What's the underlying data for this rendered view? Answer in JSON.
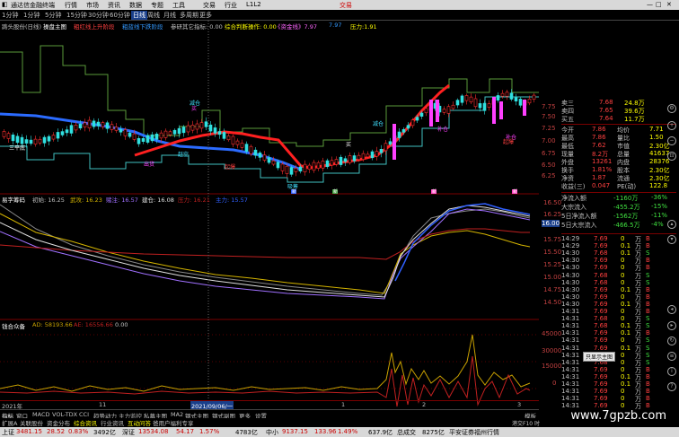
{
  "window": {
    "title": "通达信金融终端",
    "menus": [
      "行情",
      "市场",
      "资讯",
      "数据",
      "专题",
      "工具",
      "交易",
      "行业",
      "L1L2"
    ],
    "trade_label": "交易"
  },
  "periods": [
    "1分钟",
    "1分钟",
    "5分钟",
    "15分钟",
    "30分钟",
    "60分钟",
    "日线",
    "周线",
    "月线",
    "多周期",
    "更多"
  ],
  "selected_period": "日线",
  "indicator_bar": {
    "stock": "踌头股份(日线)",
    "item1": "操盘主图",
    "item2": "粗红线上升阶段",
    "item3": "粗蓝线下跌阶段",
    "item4": "参研其它指标: 0.00",
    "item5": "综合判断操作: 0.00",
    "item6": "《资金线》7.97",
    "item7": "7.97",
    "item8": "压力:1.91"
  },
  "main_chart": {
    "labels": {
      "buy": "买",
      "sell": "卖",
      "jian": "减仓",
      "bu": "补仓",
      "qi": "起爆",
      "sanping": "三平底",
      "xishou": "吸筹",
      "ganping": "赶空",
      "chuhuo": "出货"
    },
    "marker_labels": [
      "新",
      "新",
      "新",
      "新"
    ]
  },
  "panel2": {
    "title": "易字筹码",
    "items": [
      "初始: 16.25",
      "武攻: 16.23",
      "赌注: 16.57",
      "建仓: 16.08",
      "压力: 16.21",
      "主力: 15.57"
    ],
    "right_ticks": [
      "16.50",
      "16.25",
      "16.00",
      "15.75",
      "15.50",
      "15.25",
      "15.00",
      "14.75",
      "14.50"
    ],
    "tag": "16.00"
  },
  "panel3": {
    "title": "钱合众备",
    "ad": "AD: 58193.66",
    "ae": "AE: 16556.66",
    "zero": "0.00",
    "right_ticks": [
      "45000",
      "30000",
      "15000",
      "0"
    ]
  },
  "date_axis": {
    "labels": [
      "2021年",
      "11",
      "12",
      "1",
      "2",
      "3"
    ],
    "cursor": "2021/09/06/一"
  },
  "tabs_row1": [
    "指标",
    "窗口",
    "MACD",
    "VOL-TDX",
    "CCI",
    "趋势动力",
    "主力监控",
    "私募主图",
    "MA2",
    "钢式主图",
    "钢式副图",
    "更多",
    "设置"
  ],
  "tabs_row2": [
    "扩展A",
    "关联股份",
    "资金分布",
    "综合资讯",
    "行业资讯",
    "互动问答",
    "爸用户福利专享"
  ],
  "tabs_row1_right": "模板",
  "right_panel": {
    "asks": [
      {
        "label": "卖三",
        "price": "7.68",
        "vol": "24.8万"
      },
      {
        "label": "卖四",
        "price": "7.65",
        "vol": "39.6万"
      },
      {
        "label": "买五",
        "price": "7.64",
        "vol": "11.7万"
      }
    ],
    "stats": [
      {
        "l": "今开",
        "v": "7.86",
        "l2": "均价",
        "v2": "7.71"
      },
      {
        "l": "最高",
        "v": "7.86",
        "l2": "量比",
        "v2": "1.50"
      },
      {
        "l": "最低",
        "v": "7.62",
        "l2": "市值",
        "v2": "2.30亿"
      },
      {
        "l": "现量",
        "v": "8.2万",
        "l2": "总量",
        "v2": "41637"
      },
      {
        "l": "外盘",
        "v": "13261",
        "l2": "内盘",
        "v2": "28376"
      },
      {
        "l": "换手",
        "v": "1.81%",
        "l2": "股本",
        "v2": "2.30亿"
      },
      {
        "l": "净资",
        "v": "1.87",
        "l2": "流通",
        "v2": "2.30亿"
      },
      {
        "l": "收益(三)",
        "v": "0.047",
        "l2": "PE(动)",
        "v2": "122.8"
      }
    ],
    "flows": [
      {
        "l": "净流入额",
        "v": "-1160万",
        "p": "-36%"
      },
      {
        "l": "大宗流入",
        "v": "-455.2万",
        "p": "-15%"
      },
      {
        "l": "5日净流入额",
        "v": "-1562万",
        "p": "-11%"
      },
      {
        "l": "5日大宗流入",
        "v": "-466.5万",
        "p": "-4%"
      }
    ],
    "ticks": [
      {
        "t": "14:29",
        "p": "7.69",
        "v": "0",
        "u": "万",
        "d": "B"
      },
      {
        "t": "14:29",
        "p": "7.69",
        "v": "0.1",
        "u": "万",
        "d": "B"
      },
      {
        "t": "14:30",
        "p": "7.68",
        "v": "0.1",
        "u": "万",
        "d": "S"
      },
      {
        "t": "14:30",
        "p": "7.69",
        "v": "0",
        "u": "万",
        "d": "B"
      },
      {
        "t": "14:30",
        "p": "7.69",
        "v": "0",
        "u": "万",
        "d": "B"
      },
      {
        "t": "14:30",
        "p": "7.68",
        "v": "0",
        "u": "万",
        "d": "S"
      },
      {
        "t": "14:30",
        "p": "7.68",
        "v": "0",
        "u": "万",
        "d": "S"
      },
      {
        "t": "14:30",
        "p": "7.69",
        "v": "0.1",
        "u": "万",
        "d": "B"
      },
      {
        "t": "14:30",
        "p": "7.69",
        "v": "0",
        "u": "万",
        "d": "B"
      },
      {
        "t": "14:30",
        "p": "7.69",
        "v": "0.1",
        "u": "万",
        "d": "B"
      },
      {
        "t": "14:31",
        "p": "7.69",
        "v": "0",
        "u": "万",
        "d": "B"
      },
      {
        "t": "14:31",
        "p": "7.68",
        "v": "0",
        "u": "万",
        "d": "S"
      },
      {
        "t": "14:31",
        "p": "7.68",
        "v": "0.1",
        "u": "万",
        "d": "S"
      },
      {
        "t": "14:31",
        "p": "7.69",
        "v": "0.1",
        "u": "万",
        "d": "B"
      },
      {
        "t": "14:31",
        "p": "7.69",
        "v": "0",
        "u": "万",
        "d": "S"
      },
      {
        "t": "14:31",
        "p": "7.69",
        "v": "0.1",
        "u": "万",
        "d": "S"
      },
      {
        "t": "14:31",
        "p": "7.68",
        "v": "0",
        "u": "万",
        "d": "S"
      },
      {
        "t": "14:31",
        "p": "7.68",
        "v": "0",
        "u": "万",
        "d": "S"
      },
      {
        "t": "14:31",
        "p": "7.69",
        "v": "0",
        "u": "万",
        "d": "B"
      },
      {
        "t": "14:31",
        "p": "7.69",
        "v": "0.1",
        "u": "万",
        "d": "B"
      },
      {
        "t": "14:31",
        "p": "7.69",
        "v": "0.1",
        "u": "万",
        "d": "B"
      },
      {
        "t": "14:31",
        "p": "7.69",
        "v": "0",
        "u": "万",
        "d": "B"
      },
      {
        "t": "14:31",
        "p": "7.69",
        "v": "0",
        "u": "万",
        "d": "B"
      },
      {
        "t": "14:31",
        "p": "7.69",
        "v": "0",
        "u": "万",
        "d": "B"
      }
    ],
    "price_ticks": [
      "7.75",
      "7.50",
      "7.25",
      "7.00",
      "6.75",
      "6.50",
      "6.25"
    ],
    "popup": "只显示主图",
    "bottom_tag": "港交F10 时"
  },
  "status": {
    "sh_label": "上证",
    "sh_val": "3481.15",
    "sh_chg": "28.52",
    "sh_pct": "0.83%",
    "sh_amt": "3492亿",
    "sz_label": "深证",
    "sz_val": "13534.08",
    "sz_chg": "54.17",
    "sz_pct": "1.57%",
    "sz_amt": "4783亿",
    "zx_label": "中小",
    "zx_val": "9137.15",
    "zx_chg": "133.96",
    "zx_pct": "1.49%",
    "zx_amt": "637.9亿",
    "zc_label": "总成交",
    "zc_val": "8275亿",
    "news": "平安证券福州行情"
  },
  "watermark": "www.7gpzb.com"
}
